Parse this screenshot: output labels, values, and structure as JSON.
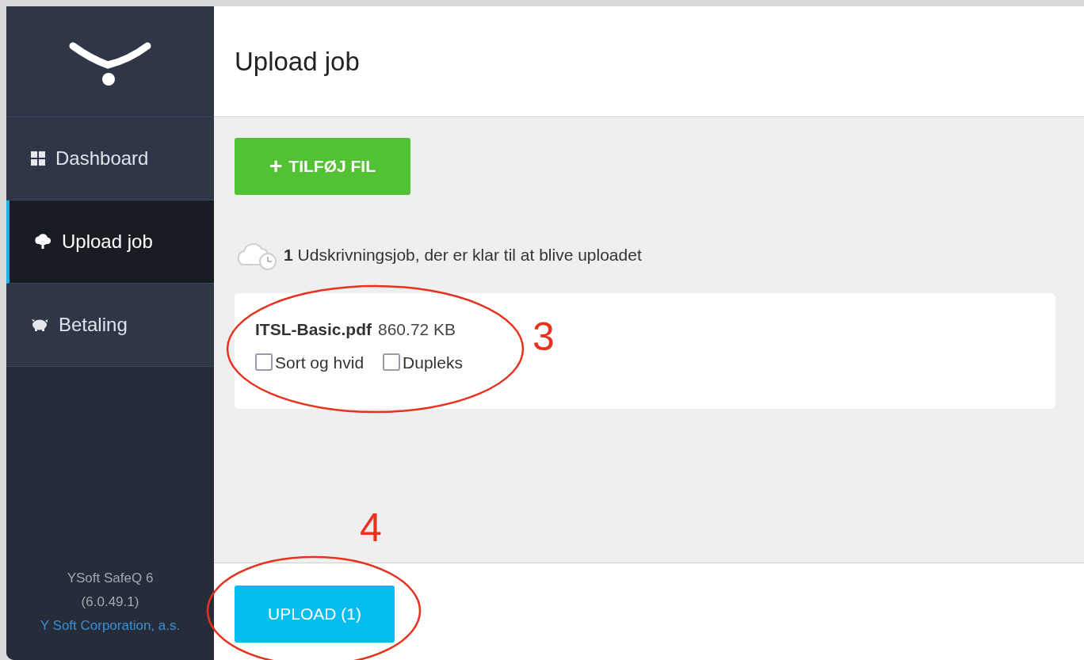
{
  "sidebar": {
    "items": [
      {
        "label": "Dashboard",
        "kind": "grid",
        "selected": false
      },
      {
        "label": "Upload job",
        "kind": "upload",
        "selected": true
      },
      {
        "label": "Betaling",
        "kind": "payment",
        "selected": false
      }
    ],
    "footer": {
      "product": "YSoft SafeQ 6",
      "version": "(6.0.49.1)",
      "company": "Y Soft Corporation, a.s."
    }
  },
  "header": {
    "title": "Upload job"
  },
  "add_file_button": {
    "icon": "+",
    "label": "TILFØJ FIL"
  },
  "status": {
    "count": "1",
    "text": "Udskrivningsjob, der er klar til at blive uploadet"
  },
  "files": [
    {
      "name": "ITSL-Basic.pdf",
      "size": "860.72 KB",
      "annotation": "3",
      "options": [
        {
          "label": "Sort og hvid",
          "checked": false
        },
        {
          "label": "Dupleks",
          "checked": false
        }
      ]
    }
  ],
  "upload_button": {
    "label": "UPLOAD (1)",
    "annotation": "4"
  }
}
